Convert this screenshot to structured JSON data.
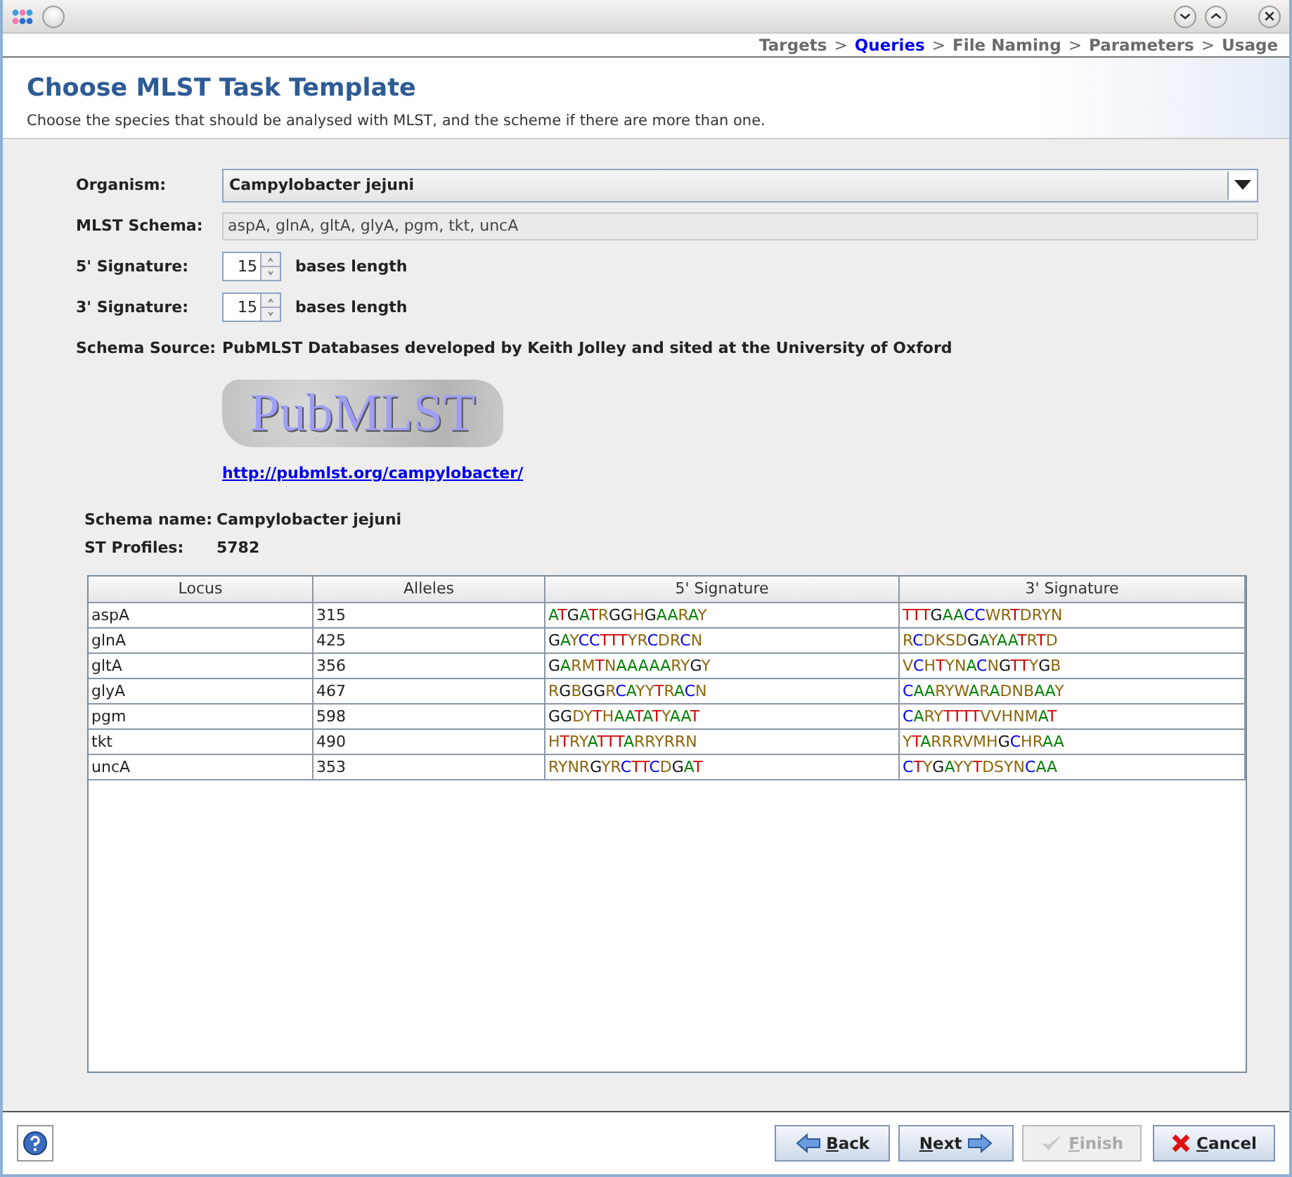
{
  "steps": [
    {
      "label": "Targets",
      "selected": false
    },
    {
      "label": "Queries",
      "selected": true
    },
    {
      "label": "File Naming",
      "selected": false
    },
    {
      "label": "Parameters",
      "selected": false
    },
    {
      "label": "Usage",
      "selected": false
    }
  ],
  "step_separator": ">",
  "header": {
    "title": "Choose MLST Task Template",
    "subtitle": "Choose the species that should be analysed with MLST, and the scheme if there are more than one."
  },
  "form": {
    "organism_label": "Organism:",
    "organism": "Campylobacter jejuni",
    "schema_label": "MLST Schema:",
    "schema": "aspA, glnA, gltA, glyA, pgm, tkt, uncA",
    "signatures": [
      {
        "label": "5' Signature:",
        "value": "15",
        "unit": "bases length"
      },
      {
        "label": "3' Signature:",
        "value": "15",
        "unit": "bases length"
      }
    ],
    "source_label": "Schema Source:",
    "source": "PubMLST Databases developed by Keith Jolley and sited at the University of Oxford",
    "logo_text": "PubMLST",
    "link": "http://pubmlst.org/campylobacter/",
    "schema_name_label": "Schema name:",
    "schema_name": "Campylobacter jejuni",
    "profiles_label": "ST Profiles:",
    "profiles": "5782"
  },
  "table": {
    "columns": [
      "Locus",
      "Alleles",
      "5' Signature",
      "3' Signature"
    ],
    "rows": [
      [
        "aspA",
        "315",
        "ATGATRGGHGAARAY",
        "TTTGAACCWRTDRYN"
      ],
      [
        "glnA",
        "425",
        "GAYCCTTTYRCDRCN",
        "RCDKSDGAYAATRTD"
      ],
      [
        "gltA",
        "356",
        "GARMTNAAAAARYGY",
        "VCHTYNACNGTTYGB"
      ],
      [
        "glyA",
        "467",
        "RGBGGRCAYYTRACN",
        "CAARYWARADNBAAY"
      ],
      [
        "pgm",
        "598",
        "GGDYTHAATATYAAT",
        "CARYTTTTVVHNMAT"
      ],
      [
        "tkt",
        "490",
        "HTRYATTTARRYRRN",
        "YTARRRVMHGCHRAA"
      ],
      [
        "uncA",
        "353",
        "RYNRGYRCTTCDGAT",
        "CTYGAYYTDSYNCAA"
      ]
    ]
  },
  "buttons": [
    {
      "label": "Back",
      "kind": "back",
      "disabled": false
    },
    {
      "label": "Next",
      "kind": "next",
      "disabled": false
    },
    {
      "label": "Finish",
      "kind": "finish",
      "disabled": true
    },
    {
      "label": "Cancel",
      "kind": "cancel",
      "disabled": false
    }
  ]
}
